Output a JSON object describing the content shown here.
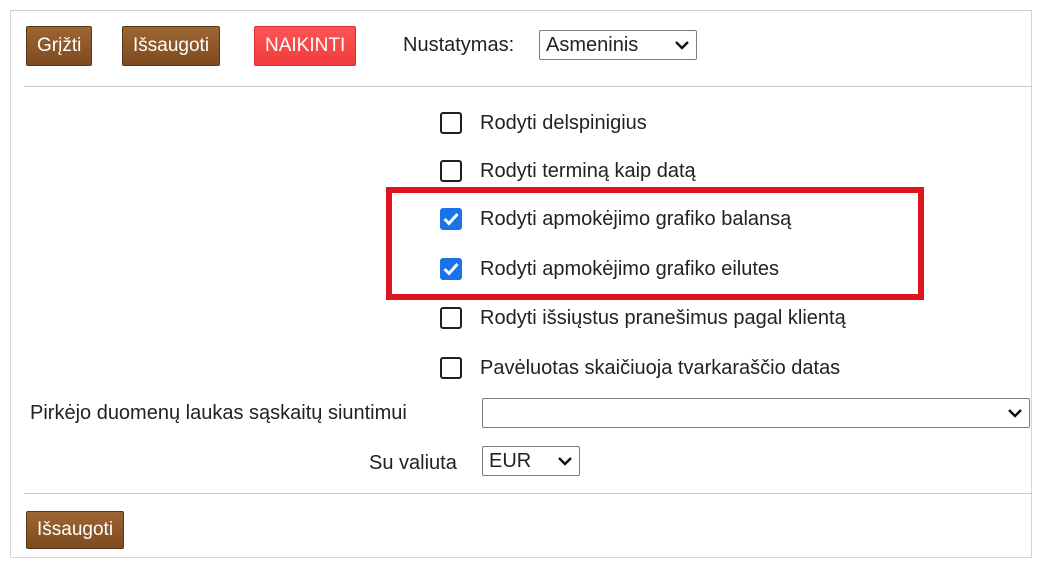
{
  "toolbar": {
    "back_label": "Grįžti",
    "save_label": "Išsaugoti",
    "delete_label": "NAIKINTI",
    "setting_label": "Nustatymas:",
    "setting_value": "Asmeninis"
  },
  "options": [
    {
      "label": "Rodyti delspinigius",
      "checked": false
    },
    {
      "label": "Rodyti terminą kaip datą",
      "checked": false
    },
    {
      "label": "Rodyti apmokėjimo grafiko balansą",
      "checked": true
    },
    {
      "label": "Rodyti apmokėjimo grafiko eilutes",
      "checked": true
    },
    {
      "label": "Rodyti išsiųstus pranešimus pagal klientą",
      "checked": false
    },
    {
      "label": "Pavėluotas skaičiuoja tvarkaraščio datas",
      "checked": false
    }
  ],
  "fields": {
    "buyer_field_label": "Pirkėjo duomenų laukas sąskaitų siuntimui",
    "buyer_field_value": "",
    "currency_label": "Su valiuta",
    "currency_value": "EUR"
  },
  "footer": {
    "save_label": "Išsaugoti"
  },
  "colors": {
    "button_brown": "#8b5528",
    "button_danger": "#f54646",
    "checkbox_checked": "#1a73e8",
    "highlight_red": "#e0141e"
  },
  "icons": {
    "dropdown": "chevron-down-icon",
    "check": "checkmark-icon"
  }
}
